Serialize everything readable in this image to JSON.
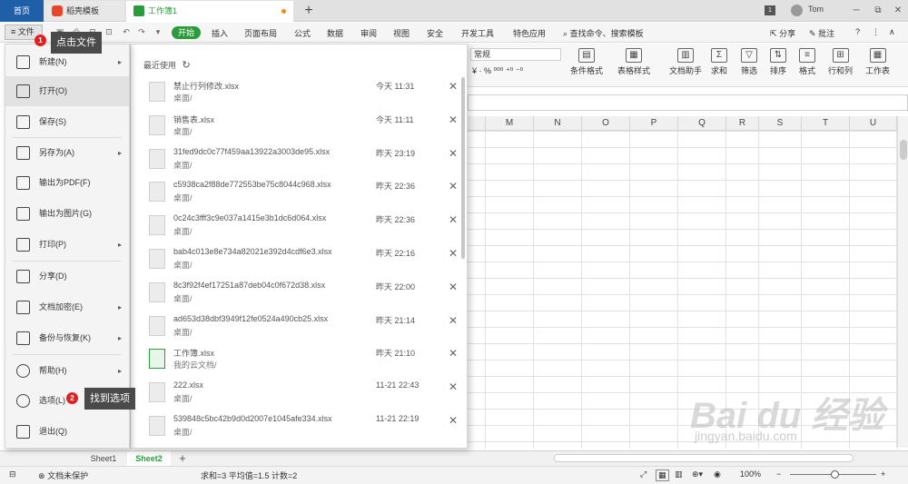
{
  "titlebar": {
    "tab_home": "首页",
    "tab_templates": "稻壳模板",
    "tab_workbook": "工作簿1",
    "new_tab": "+",
    "badge": "1",
    "user": "Tom",
    "min": "─",
    "restore": "⧉",
    "close": "✕"
  },
  "ribbon": {
    "file_label": "≡ 文件",
    "tabs": [
      "开始",
      "插入",
      "页面布局",
      "公式",
      "数据",
      "审阅",
      "视图",
      "安全",
      "开发工具",
      "特色应用"
    ],
    "search": "查找命令、搜索模板",
    "share": "分享",
    "annotate": "批注",
    "help": "?",
    "more": "⋮"
  },
  "toolbar": {
    "number_format": "常规",
    "number_row": "¥ ·  %  ⁰⁰⁰  ⁺⁰  ⁻⁰",
    "buttons": [
      "条件格式",
      "表格样式",
      "文档助手",
      "求和",
      "筛选",
      "排序",
      "格式",
      "行和列",
      "工作表"
    ]
  },
  "grid": {
    "columns": [
      "M",
      "N",
      "O",
      "P",
      "Q",
      "R",
      "S",
      "T",
      "U"
    ]
  },
  "file_menu": {
    "items": [
      {
        "label": "新建(N)",
        "arrow": "▸"
      },
      {
        "label": "打开(O)",
        "arrow": ""
      },
      {
        "label": "保存(S)",
        "arrow": ""
      },
      {
        "label": "另存为(A)",
        "arrow": "▸"
      },
      {
        "label": "输出为PDF(F)",
        "arrow": ""
      },
      {
        "label": "输出为图片(G)",
        "arrow": ""
      },
      {
        "label": "打印(P)",
        "arrow": "▸"
      },
      {
        "label": "分享(D)",
        "arrow": ""
      },
      {
        "label": "文档加密(E)",
        "arrow": "▸"
      },
      {
        "label": "备份与恢复(K)",
        "arrow": "▸"
      },
      {
        "label": "帮助(H)",
        "arrow": "▸"
      },
      {
        "label": "选项(L)",
        "arrow": ""
      },
      {
        "label": "退出(Q)",
        "arrow": ""
      }
    ]
  },
  "recent": {
    "title": "最近使用",
    "refresh": "↻",
    "close_glyph": "✕",
    "files": [
      {
        "name": "禁止行列修改.xlsx",
        "location": "桌面/",
        "time": "今天 11:31"
      },
      {
        "name": "销售表.xlsx",
        "location": "桌面/",
        "time": "今天 11:11"
      },
      {
        "name": "31fed9dc0c77f459aa13922a3003de95.xlsx",
        "location": "桌面/",
        "time": "昨天 23:19"
      },
      {
        "name": "c5938ca2f88de772553be75c8044c968.xlsx",
        "location": "桌面/",
        "time": "昨天 22:36"
      },
      {
        "name": "0c24c3fff3c9e037a1415e3b1dc6d064.xlsx",
        "location": "桌面/",
        "time": "昨天 22:36"
      },
      {
        "name": "bab4c013e8e734a82021e392d4cdf6e3.xlsx",
        "location": "桌面/",
        "time": "昨天 22:16"
      },
      {
        "name": "8c3f92f4ef17251a87deb04c0f672d38.xlsx",
        "location": "桌面/",
        "time": "昨天 22:00"
      },
      {
        "name": "ad653d38dbf3949f12fe0524a490cb25.xlsx",
        "location": "桌面/",
        "time": "昨天 21:14"
      },
      {
        "name": "工作簿.xlsx",
        "location": "我的云文档/",
        "time": "昨天 21:10"
      },
      {
        "name": "222.xlsx",
        "location": "桌面/",
        "time": "11-21 22:43"
      },
      {
        "name": "539848c5bc42b9d0d2007e1045afe334.xlsx",
        "location": "桌面/",
        "time": "11-21 22:19"
      }
    ]
  },
  "annotations": {
    "step1_num": "1",
    "step1_text": "点击文件",
    "step2_num": "2",
    "step2_text": "找到选项"
  },
  "sheets": {
    "tabs": [
      "Sheet1",
      "Sheet2"
    ],
    "add": "+"
  },
  "status": {
    "protect": "文档未保护",
    "stats": "求和=3   平均值=1.5   计数=2",
    "zoom": "100%",
    "zoom_minus": "−",
    "zoom_plus": "+"
  },
  "watermark": {
    "main": "Bai du 经验",
    "sub": "jingyan.baidu.com"
  }
}
